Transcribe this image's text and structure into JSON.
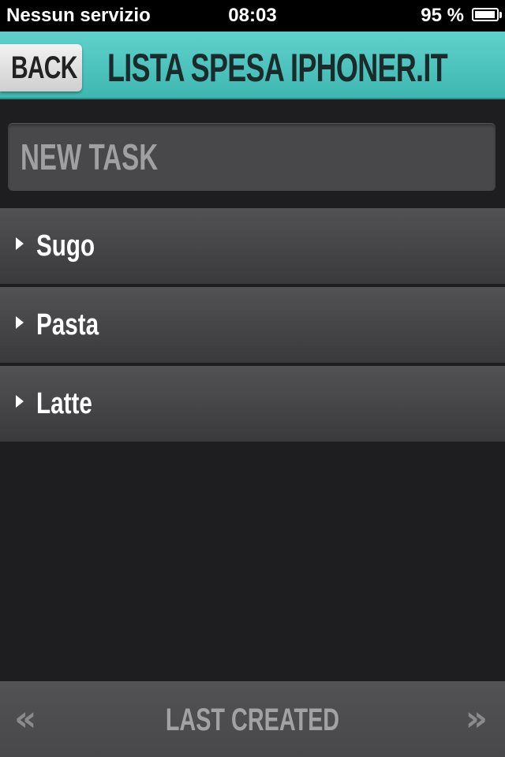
{
  "status_bar": {
    "carrier": "Nessun servizio",
    "time": "08:03",
    "battery_text": "95 %",
    "battery_level": 0.95
  },
  "header": {
    "back_label": "BACK",
    "title": "LISTA SPESA IPHONER.IT"
  },
  "new_task": {
    "placeholder": "NEW TASK",
    "value": ""
  },
  "tasks": [
    {
      "label": "Sugo"
    },
    {
      "label": "Pasta"
    },
    {
      "label": "Latte"
    }
  ],
  "bottom_bar": {
    "prev_label": "«",
    "next_label": "»",
    "sort_label": "LAST CREATED"
  },
  "colors": {
    "accent": "#4cc4be",
    "background": "#1e1e20",
    "row": "#48484a"
  }
}
